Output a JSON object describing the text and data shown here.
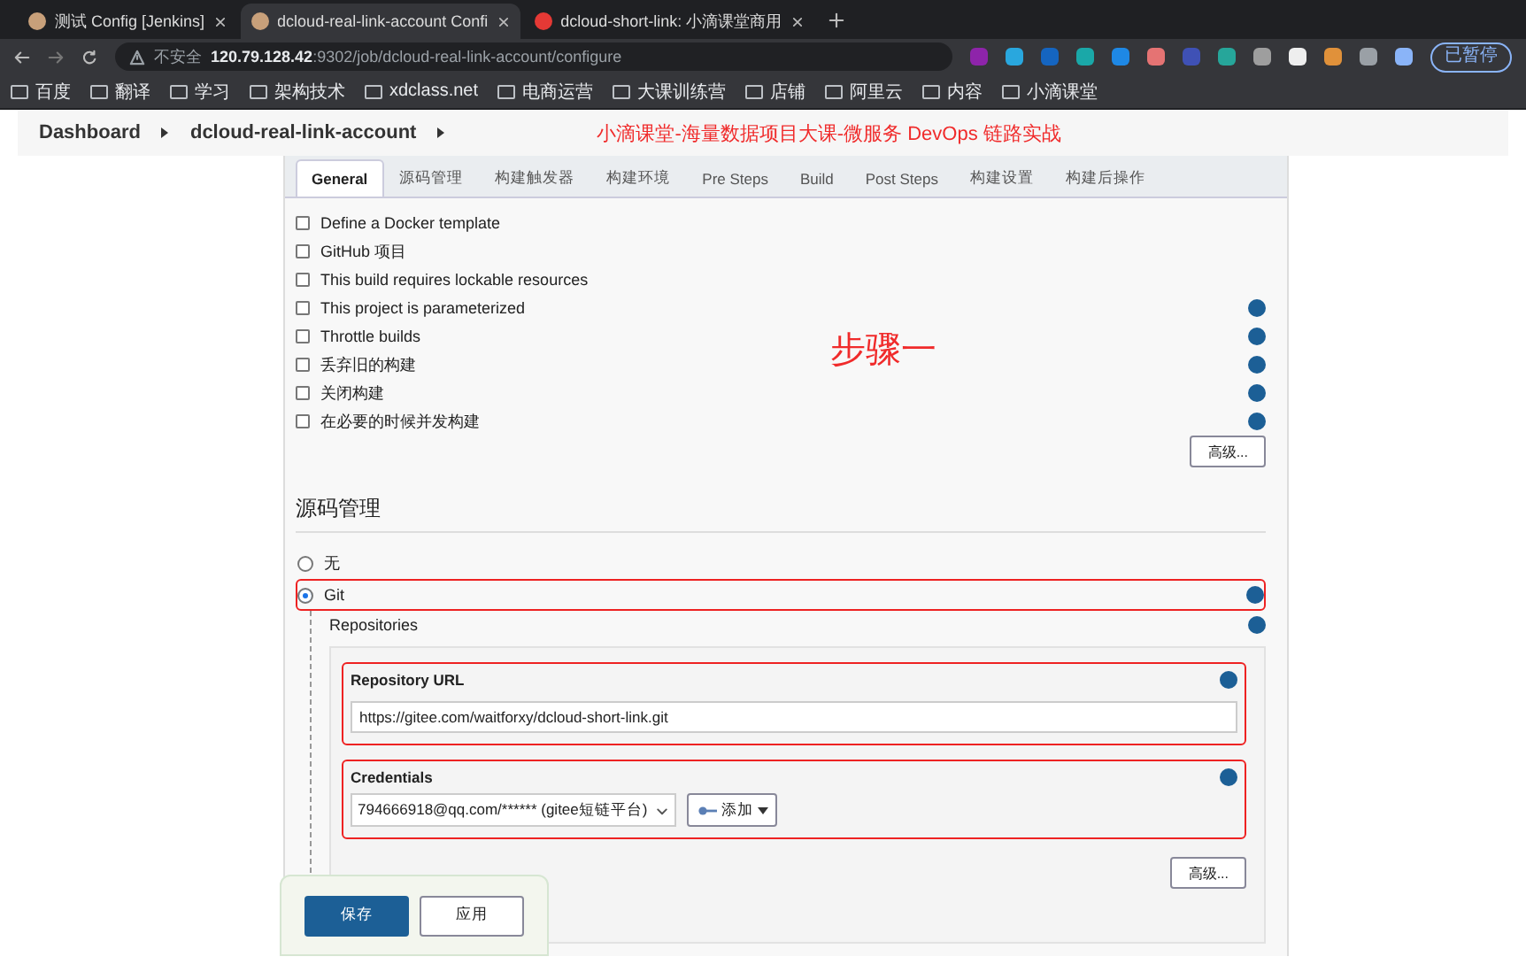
{
  "browser": {
    "tabs": [
      {
        "title": "测试 Config [Jenkins]",
        "selected": false
      },
      {
        "title": "dcloud-real-link-account Confi",
        "selected": true
      },
      {
        "title": "dcloud-short-link: 小滴课堂商用",
        "selected": false
      }
    ],
    "address": {
      "security": "不安全",
      "host": "120.79.128.42",
      "path": ":9302/job/dcloud-real-link-account/configure"
    },
    "bookmarks": [
      "百度",
      "翻译",
      "学习",
      "架构技术",
      "xdclass.net",
      "电商运营",
      "大课训练营",
      "店铺",
      "阿里云",
      "内容",
      "小滴课堂"
    ],
    "profile": "已暂停"
  },
  "breadcrumb": [
    "Dashboard",
    "dcloud-real-link-account"
  ],
  "annotations": {
    "banner": "小滴课堂-海量数据项目大课-微服务 DevOps 链路实战",
    "step": "步骤一"
  },
  "config_tabs": [
    {
      "label": "General",
      "selected": true
    },
    {
      "label": "源码管理",
      "selected": false
    },
    {
      "label": "构建触发器",
      "selected": false
    },
    {
      "label": "构建环境",
      "selected": false
    },
    {
      "label": "Pre Steps",
      "selected": false
    },
    {
      "label": "Build",
      "selected": false
    },
    {
      "label": "Post Steps",
      "selected": false
    },
    {
      "label": "构建设置",
      "selected": false
    },
    {
      "label": "构建后操作",
      "selected": false
    }
  ],
  "options": [
    {
      "label": "Define a Docker template",
      "checked": false,
      "help": false
    },
    {
      "label": "GitHub 项目",
      "checked": false,
      "help": false
    },
    {
      "label": "This build requires lockable resources",
      "checked": false,
      "help": false
    },
    {
      "label": "This project is parameterized",
      "checked": false,
      "help": true
    },
    {
      "label": "Throttle builds",
      "checked": false,
      "help": true
    },
    {
      "label": "丢弃旧的构建",
      "checked": false,
      "help": true
    },
    {
      "label": "关闭构建",
      "checked": false,
      "help": true
    },
    {
      "label": "在必要的时候并发构建",
      "checked": false,
      "help": true
    }
  ],
  "general_advanced": "高级...",
  "scm": {
    "heading": "源码管理",
    "radios": [
      {
        "label": "无",
        "selected": false,
        "highlighted": false
      },
      {
        "label": "Git",
        "selected": true,
        "highlighted": true
      }
    ],
    "repositories": "Repositories",
    "repository_url": {
      "label": "Repository URL",
      "value": "https://gitee.com/waitforxy/dcloud-short-link.git",
      "highlighted": true
    },
    "credentials": {
      "label": "Credentials",
      "value": "794666918@qq.com/****** (gitee短链平台)",
      "add": "添加",
      "highlighted": true
    },
    "advanced": "高级..."
  },
  "buttons": {
    "save": "保存",
    "apply": "应用"
  }
}
